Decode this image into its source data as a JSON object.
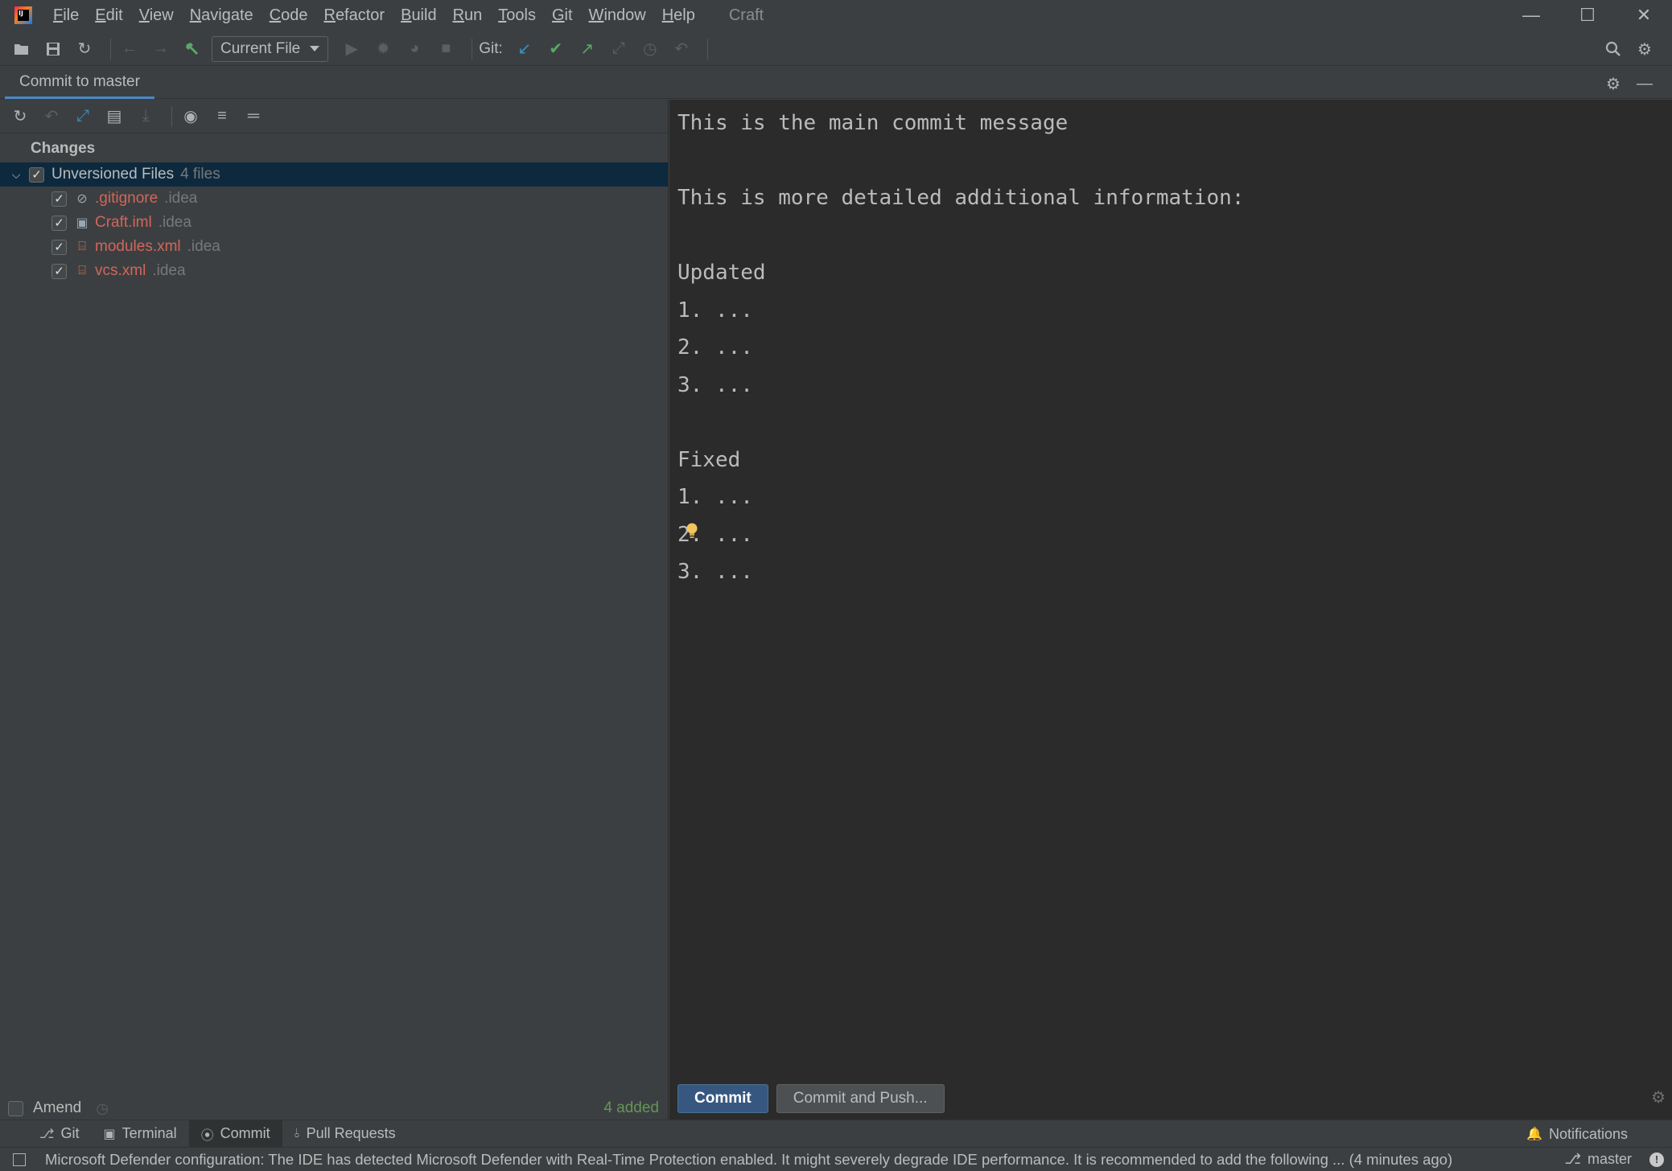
{
  "window": {
    "project_name": "Craft",
    "controls": {
      "minimize": "—",
      "maximize": "☐",
      "close": "✕"
    }
  },
  "menu": [
    "File",
    "Edit",
    "View",
    "Navigate",
    "Code",
    "Refactor",
    "Build",
    "Run",
    "Tools",
    "Git",
    "Window",
    "Help"
  ],
  "toolbar": {
    "run_config": "Current File",
    "git_label": "Git:",
    "icons": {
      "open": "folder-open-icon",
      "save": "save-icon",
      "sync": "sync-icon",
      "back": "arrow-left-icon",
      "forward": "arrow-right-icon",
      "build": "hammer-icon",
      "run": "run-icon",
      "debug": "debug-icon",
      "coverage": "coverage-icon",
      "stop": "stop-icon",
      "git_update": "git-update-icon",
      "git_commit": "git-commit-icon",
      "git_push": "git-push-icon",
      "git_compare": "git-compare-icon",
      "git_history": "history-icon",
      "git_rollback": "rollback-icon",
      "search": "search-icon",
      "settings": "settings-icon"
    }
  },
  "tool_window": {
    "tab_label": "Commit to master"
  },
  "changes": {
    "header": "Changes",
    "group": {
      "name": "Unversioned Files",
      "count": "4 files",
      "checked": true
    },
    "files": [
      {
        "name": ".gitignore",
        "dir": ".idea",
        "icon": "gitignore-file-icon",
        "checked": true
      },
      {
        "name": "Craft.iml",
        "dir": ".idea",
        "icon": "iml-file-icon",
        "checked": true
      },
      {
        "name": "modules.xml",
        "dir": ".idea",
        "icon": "xml-file-icon",
        "checked": true
      },
      {
        "name": "vcs.xml",
        "dir": ".idea",
        "icon": "xml-file-icon",
        "checked": true
      }
    ]
  },
  "amend": {
    "label": "Amend",
    "checked": false,
    "added": "4 added"
  },
  "commit_message": {
    "lines": [
      "This is the main commit message",
      "",
      "This is more detailed additional information:",
      "",
      "Updated",
      "1. ...",
      "2. ...",
      "3. ...",
      "",
      "Fixed",
      "1. ...",
      "2. ...",
      "3. ..."
    ]
  },
  "actions": {
    "commit": "Commit",
    "commit_and_push": "Commit and Push..."
  },
  "bottom_tabs": [
    {
      "label": "Git",
      "icon": "branch-icon"
    },
    {
      "label": "Terminal",
      "icon": "terminal-icon"
    },
    {
      "label": "Commit",
      "icon": "commit-icon",
      "active": true
    },
    {
      "label": "Pull Requests",
      "icon": "pull-request-icon"
    }
  ],
  "notifications_label": "Notifications",
  "status": {
    "message": "Microsoft Defender configuration: The IDE has detected Microsoft Defender with Real-Time Protection enabled. It might severely degrade IDE performance. It is recommended to add the following ... (4 minutes ago)",
    "branch": "master"
  }
}
